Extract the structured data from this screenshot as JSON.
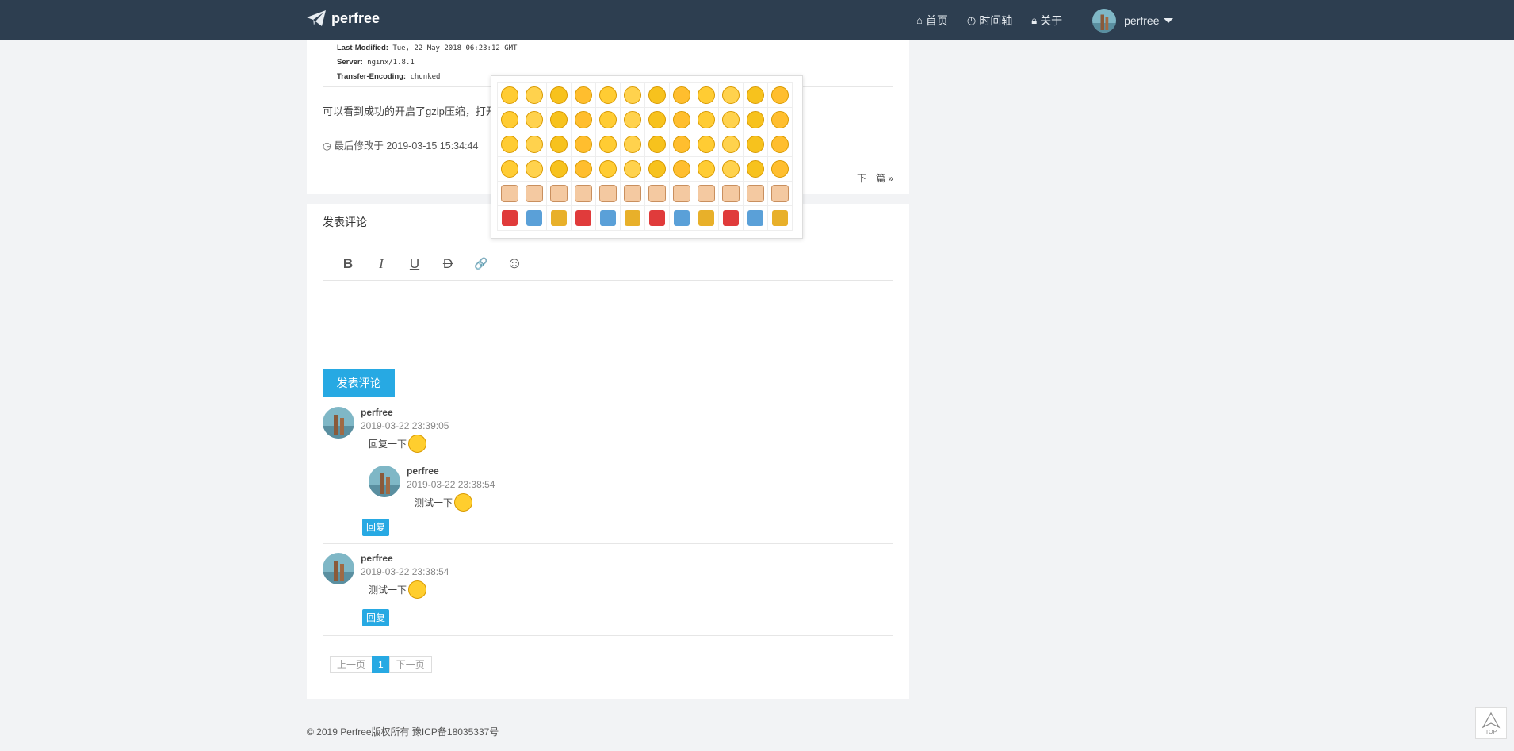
{
  "nav": {
    "brand": "perfree",
    "links": [
      {
        "icon": "home-icon",
        "label": "首页"
      },
      {
        "icon": "clock-icon",
        "label": "时间轴"
      },
      {
        "icon": "lock-icon",
        "label": "关于"
      }
    ],
    "user": "perfree"
  },
  "article": {
    "http_lines": [
      {
        "key": "Last-Modified:",
        "value": "Tue, 22 May 2018 06:23:12 GMT"
      },
      {
        "key": "Server:",
        "value": "nginx/1.8.1"
      },
      {
        "key": "Transfer-Encoding:",
        "value": "chunked"
      }
    ],
    "paragraph": "可以看到成功的开启了gzip压缩，打开",
    "modified": "最后修改于 2019-03-15 15:34:44",
    "next": "下一篇 »"
  },
  "comment_form": {
    "title": "发表评论",
    "toolbar": [
      {
        "name": "bold-button",
        "glyph": "B"
      },
      {
        "name": "italic-button",
        "glyph": "I"
      },
      {
        "name": "underline-button",
        "glyph": "U"
      },
      {
        "name": "strikethrough-button",
        "glyph": "D"
      },
      {
        "name": "link-button",
        "glyph": "🔗"
      },
      {
        "name": "emoji-button",
        "glyph": "☺"
      }
    ],
    "submit": "发表评论"
  },
  "comments": [
    {
      "name": "perfree",
      "time": "2019-03-22 23:39:05",
      "text": "回复一下",
      "reply": "回复"
    },
    {
      "name": "perfree",
      "time": "2019-03-22 23:38:54",
      "text": "测试一下"
    },
    {
      "name": "perfree",
      "time": "2019-03-22 23:38:54",
      "text": "测试一下",
      "reply": "回复"
    }
  ],
  "pagination": {
    "prev": "上一页",
    "current": "1",
    "next": "下一页"
  },
  "footer": "© 2019 Perfree版权所有 豫ICP备18035337号",
  "totop": "TOP",
  "emoji_colors": [
    "#ffcc33",
    "#ffd24d",
    "#f7c21d",
    "#ffbe2e"
  ],
  "accent": "#27a9e3",
  "nav_bg": "#2d3e50"
}
